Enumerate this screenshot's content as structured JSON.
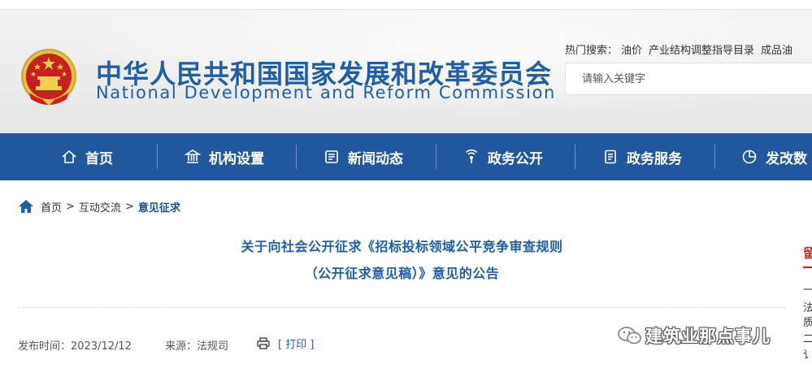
{
  "header": {
    "title_cn": "中华人民共和国国家发展和改革委员会",
    "title_en": "National Development and Reform Commission",
    "emblem_icon": "national-emblem-icon"
  },
  "hot_search": {
    "label": "热门搜索：",
    "items": [
      "油价",
      "产业结构调整指导目录",
      "成品油"
    ]
  },
  "search": {
    "placeholder": "请输入关键字"
  },
  "nav": {
    "items": [
      {
        "label": "首页",
        "icon": "home-icon"
      },
      {
        "label": "机构设置",
        "icon": "building-icon"
      },
      {
        "label": "新闻动态",
        "icon": "news-icon"
      },
      {
        "label": "政务公开",
        "icon": "broadcast-icon"
      },
      {
        "label": "政务服务",
        "icon": "document-icon"
      },
      {
        "label": "发改数",
        "icon": "pie-chart-icon"
      }
    ]
  },
  "breadcrumb": {
    "items": [
      "首页",
      "互动交流",
      "意见征求"
    ],
    "separator": ">"
  },
  "article": {
    "title_line1": "关于向社会公开征求《招标投标领域公平竞争审查规则",
    "title_line2": "（公开征求意见稿）》意见的公告",
    "publish_label": "发布时间：",
    "publish_date": "2023/12/12",
    "source_label": "来源：",
    "source": "法规司",
    "print_label": "[ 打印 ]"
  },
  "watermark": {
    "text": "建筑业那点事儿"
  },
  "sidebar_edge": {
    "head": "留",
    "chars": [
      "一",
      "法",
      "质",
      "二",
      "讠"
    ]
  },
  "colors": {
    "nav_bg": "#21579c",
    "title_blue": "#1f5ea8",
    "accent_red": "#c81e1e"
  }
}
